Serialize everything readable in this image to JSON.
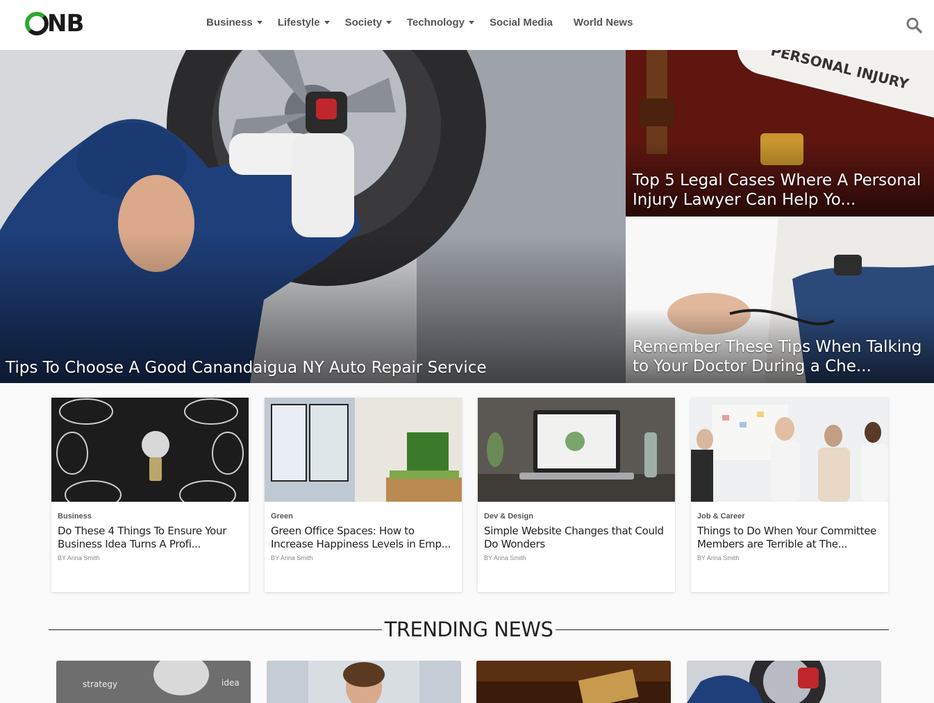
{
  "header": {
    "logo_text": "NB",
    "nav": [
      {
        "label": "Business",
        "dropdown": true
      },
      {
        "label": "Lifestyle",
        "dropdown": true
      },
      {
        "label": "Society",
        "dropdown": true
      },
      {
        "label": "Technology",
        "dropdown": true
      },
      {
        "label": "Social Media",
        "dropdown": false
      },
      {
        "label": "World News",
        "dropdown": false
      }
    ],
    "search_icon": "search-icon"
  },
  "hero": {
    "main": {
      "title": "Tips To Choose A Good Canandaigua NY Auto Repair Service"
    },
    "top_right": {
      "title": "Top 5 Legal Cases Where A Personal Injury Lawyer Can Help Yo...",
      "image_text": "PERSONAL INJURY"
    },
    "bottom_right": {
      "title": "Remember These Tips When Talking to Your Doctor During a Che..."
    }
  },
  "cards": [
    {
      "category": "Business",
      "title": "Do These 4 Things To Ensure Your Business Idea Turns A Profi...",
      "byline": "BY Arina Smith"
    },
    {
      "category": "Green",
      "title": "Green Office Spaces: How to Increase Happiness Levels in Emp...",
      "byline": "BY Arina Smith"
    },
    {
      "category": "Dev & Design",
      "title": "Simple Website Changes that Could Do Wonders",
      "byline": "BY Arina Smith"
    },
    {
      "category": "Job & Career",
      "title": "Things to Do When Your Committee Members are Terrible at The...",
      "byline": "BY Arina Smith"
    }
  ],
  "trending": {
    "heading": "TRENDING NEWS",
    "image_texts": [
      "strategy",
      "idea"
    ]
  },
  "colors": {
    "logo_green": "#2fa72f",
    "nav_text": "#555555",
    "text_dark": "#222222"
  }
}
